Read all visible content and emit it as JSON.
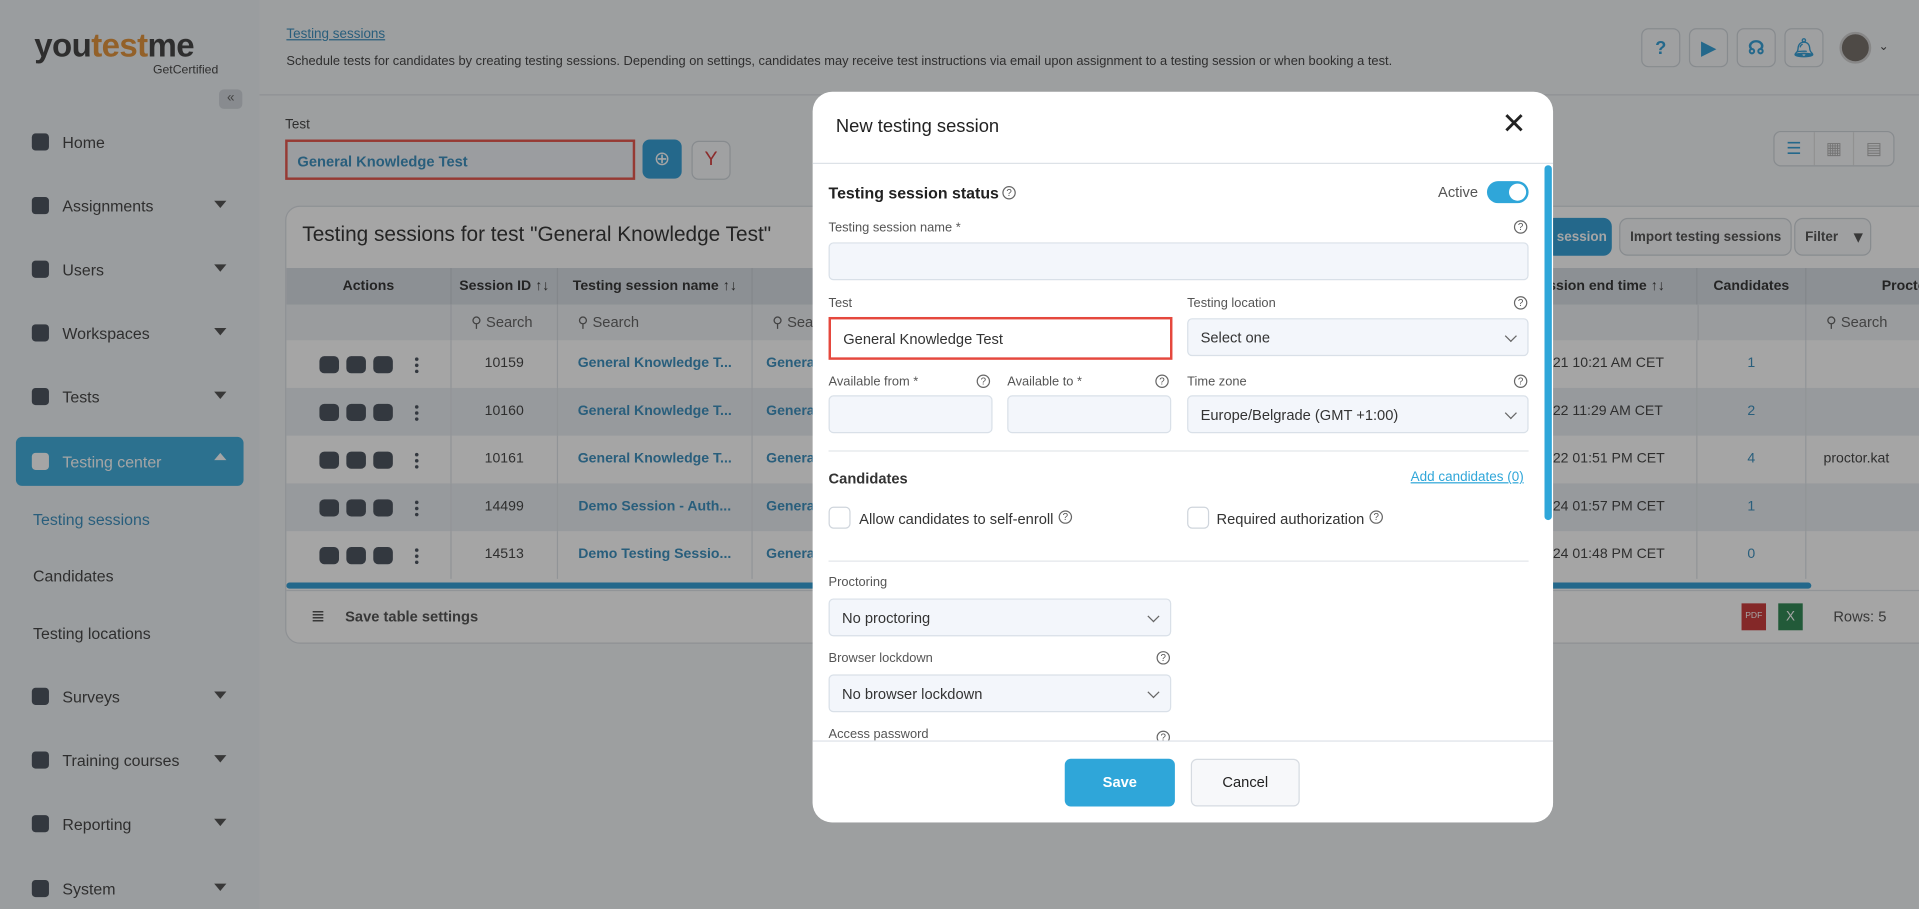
{
  "brand": {
    "name_a": "you",
    "name_b": "test",
    "name_c": "me",
    "sub": "GetCertified"
  },
  "sidebar": {
    "items": [
      {
        "label": "Home",
        "icon": "home-icon",
        "caret": false
      },
      {
        "label": "Assignments",
        "icon": "assignments-icon",
        "caret": true
      },
      {
        "label": "Users",
        "icon": "users-icon",
        "caret": true
      },
      {
        "label": "Workspaces",
        "icon": "globe-icon",
        "caret": true
      },
      {
        "label": "Tests",
        "icon": "tests-icon",
        "caret": true
      },
      {
        "label": "Testing center",
        "icon": "calendar-icon",
        "caret": true,
        "active": true
      },
      {
        "label": "Surveys",
        "icon": "surveys-icon",
        "caret": true
      },
      {
        "label": "Training courses",
        "icon": "trophy-icon",
        "caret": true
      },
      {
        "label": "Reporting",
        "icon": "reporting-icon",
        "caret": true
      },
      {
        "label": "System",
        "icon": "gear-icon",
        "caret": true
      }
    ],
    "subitems": [
      "Testing sessions",
      "Candidates",
      "Testing locations"
    ]
  },
  "header": {
    "breadcrumb": "Testing sessions",
    "description": "Schedule tests for candidates by creating testing sessions. Depending on settings, candidates may receive test instructions via email upon assignment to a testing session or when booking a test.",
    "icons": [
      "help-icon",
      "play-icon",
      "support-icon",
      "bell-icon"
    ]
  },
  "test_select": {
    "label": "Test",
    "value": "General Knowledge Test"
  },
  "card": {
    "title": "Testing sessions for test \"General Knowledge Test\"",
    "new_button": "session",
    "import_button": "Import testing sessions",
    "filter_button": "Filter",
    "columns": [
      "Actions",
      "Session ID  ↑↓",
      "Testing session name  ↑↓",
      "",
      "ssion end time  ↑↓",
      "Candidates",
      "Procto"
    ],
    "search_placeholder": "Search",
    "search_partial": "Sear",
    "rows": [
      {
        "id": "10159",
        "name": "General Knowledge T...",
        "test": "Genera",
        "end": ")21 10:21 AM CET",
        "candidates": "1",
        "proctor": ""
      },
      {
        "id": "10160",
        "name": "General Knowledge T...",
        "test": "Genera",
        "end": ")22 11:29 AM CET",
        "candidates": "2",
        "proctor": ""
      },
      {
        "id": "10161",
        "name": "General Knowledge T...",
        "test": "Genera",
        "end": ")22 01:51 PM CET",
        "candidates": "4",
        "proctor": "proctor.kat"
      },
      {
        "id": "14499",
        "name": "Demo Session - Auth...",
        "test": "Genera",
        "end": ")24 01:57 PM CET",
        "candidates": "1",
        "proctor": ""
      },
      {
        "id": "14513",
        "name": "Demo Testing Sessio...",
        "test": "Genera",
        "end": ")24 01:48 PM CET",
        "candidates": "0",
        "proctor": ""
      }
    ],
    "save_settings": "Save table settings",
    "rows_count": "Rows: 5"
  },
  "modal": {
    "title": "New testing session",
    "status_label": "Testing session status",
    "active_label": "Active",
    "active": true,
    "name_label": "Testing session name *",
    "name_value": "",
    "test_label": "Test",
    "test_value": "General Knowledge Test",
    "location_label": "Testing location",
    "location_value": "Select one",
    "from_label": "Available from *",
    "to_label": "Available to *",
    "tz_label": "Time zone",
    "tz_value": "Europe/Belgrade (GMT +1:00)",
    "candidates_label": "Candidates",
    "add_candidates": "Add candidates (0)",
    "self_enroll": "Allow candidates to self-enroll",
    "required_auth": "Required authorization",
    "proctoring_label": "Proctoring",
    "proctoring_value": "No proctoring",
    "lockdown_label": "Browser lockdown",
    "lockdown_value": "No browser lockdown",
    "password_label": "Access password",
    "save": "Save",
    "cancel": "Cancel"
  },
  "colors": {
    "accent": "#2fa6d9",
    "highlight_border": "#e5483d",
    "link": "#2a86b8"
  }
}
